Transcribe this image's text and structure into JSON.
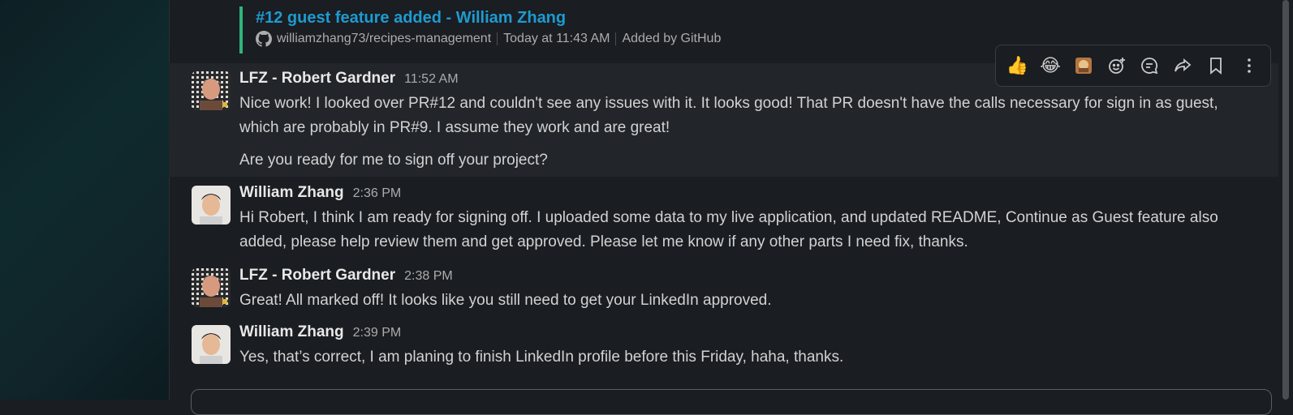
{
  "attachment": {
    "title": "#12 guest feature added - William Zhang",
    "repo": "williamzhang73/recipes-management",
    "time": "Today at 11:43 AM",
    "added_by": "Added by GitHub",
    "bar_color": "#2eb67d"
  },
  "messages": [
    {
      "author": "LFZ - Robert Gardner",
      "time": "11:52 AM",
      "lines": [
        "Nice work! I looked over PR#12 and couldn't see any issues with it. It looks good! That PR doesn't have the calls necessary for sign in as guest,",
        "which are probably in PR#9. I assume they work and are great!"
      ],
      "extra": "Are you ready for me to sign off your project?"
    },
    {
      "author": "William Zhang",
      "time": "2:36 PM",
      "lines": [
        "Hi Robert, I think I am ready for signing off. I uploaded some data to my live application, and updated README, Continue as Guest feature also",
        "added, please help review them and get approved. Please let me know if any other parts I need fix, thanks."
      ]
    },
    {
      "author": "LFZ - Robert Gardner",
      "time": "2:38 PM",
      "lines": [
        "Great! All marked off! It looks like you still need to get your LinkedIn approved."
      ]
    },
    {
      "author": "William Zhang",
      "time": "2:39 PM",
      "lines": [
        "Yes, that’s correct, I am planing to finish LinkedIn profile before this Friday, haha, thanks."
      ]
    }
  ],
  "toolbar": {
    "thumbs_up": "👍",
    "joy": "😂",
    "icons": [
      "thumbs-up",
      "laughing",
      "custom-emoji",
      "add-reaction",
      "reply-in-thread",
      "forward",
      "bookmark",
      "more-actions"
    ]
  }
}
